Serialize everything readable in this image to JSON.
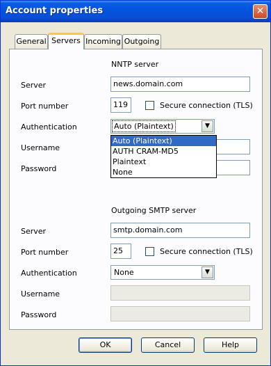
{
  "window": {
    "title": "Account properties",
    "close_symbol": "✕"
  },
  "tabs": [
    {
      "label": "General",
      "active": false
    },
    {
      "label": "Servers",
      "active": true
    },
    {
      "label": "Incoming",
      "active": false
    },
    {
      "label": "Outgoing",
      "active": false
    }
  ],
  "nntp": {
    "section_title": "NNTP server",
    "server_label": "Server",
    "server_value": "news.domain.com",
    "port_label": "Port number",
    "port_value": "119",
    "secure_label": "Secure connection (TLS)",
    "secure_checked": false,
    "auth_label": "Authentication",
    "auth_value": "Auto  (Plaintext)",
    "username_label": "Username",
    "password_label": "Password",
    "auth_options": [
      "Auto  (Plaintext)",
      "AUTH CRAM-MD5",
      "Plaintext",
      "None"
    ],
    "highlighted_option": "Auto  (Plaintext)"
  },
  "smtp": {
    "section_title": "Outgoing SMTP server",
    "server_label": "Server",
    "server_value": "smtp.domain.com",
    "port_label": "Port number",
    "port_value": "25",
    "secure_label": "Secure connection (TLS)",
    "secure_checked": false,
    "auth_label": "Authentication",
    "auth_value": "None",
    "username_label": "Username",
    "password_label": "Password"
  },
  "buttons": {
    "ok": "OK",
    "cancel": "Cancel",
    "help": "Help"
  },
  "colors": {
    "title_bar": "#0a5ddf",
    "active_tab_accent": "#ffc83c",
    "selection": "#316ac5",
    "dialog_bg": "#ece9d8"
  }
}
